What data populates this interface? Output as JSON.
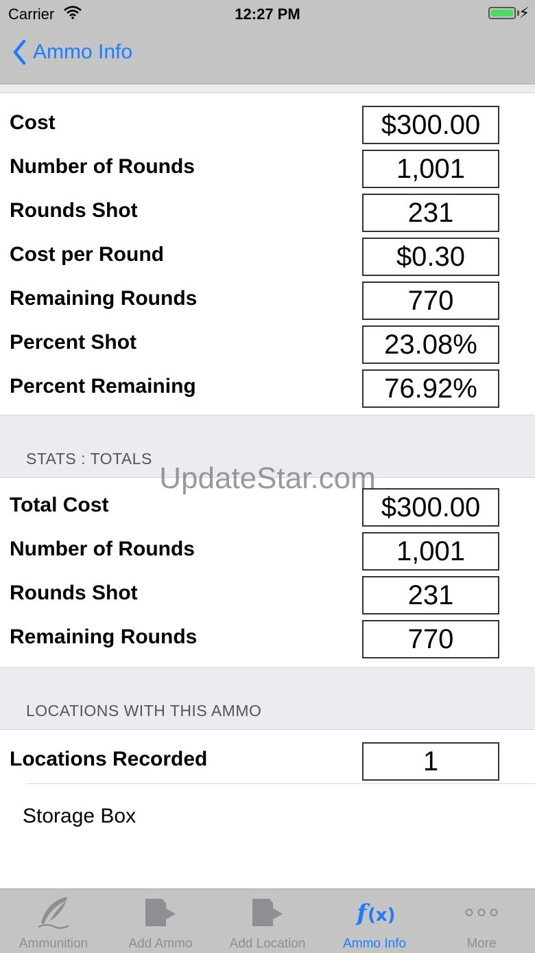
{
  "status": {
    "carrier": "Carrier",
    "time": "12:27 PM"
  },
  "nav": {
    "back_label": "Ammo Info"
  },
  "info": [
    {
      "label": "Cost",
      "value": "$300.00"
    },
    {
      "label": "Number of Rounds",
      "value": "1,001"
    },
    {
      "label": "Rounds Shot",
      "value": "231"
    },
    {
      "label": "Cost per Round",
      "value": "$0.30"
    },
    {
      "label": "Remaining Rounds",
      "value": "770"
    },
    {
      "label": "Percent Shot",
      "value": "23.08%"
    },
    {
      "label": "Percent Remaining",
      "value": "76.92%"
    }
  ],
  "totals": {
    "header": "STATS : TOTALS",
    "rows": [
      {
        "label": "Total Cost",
        "value": "$300.00"
      },
      {
        "label": "Number of Rounds",
        "value": "1,001"
      },
      {
        "label": "Rounds Shot",
        "value": "231"
      },
      {
        "label": "Remaining Rounds",
        "value": "770"
      }
    ]
  },
  "locations": {
    "header": "LOCATIONS WITH THIS AMMO",
    "recorded_label": "Locations Recorded",
    "recorded_value": "1",
    "items": [
      "Storage Box"
    ]
  },
  "watermark": "UpdateStar.com",
  "tabs": [
    {
      "label": "Ammunition",
      "icon": "quill-icon",
      "active": false
    },
    {
      "label": "Add Ammo",
      "icon": "add-document-icon",
      "active": false
    },
    {
      "label": "Add Location",
      "icon": "add-document-icon",
      "active": false
    },
    {
      "label": "Ammo Info",
      "icon": "function-icon",
      "active": true
    },
    {
      "label": "More",
      "icon": "more-icon",
      "active": false
    }
  ],
  "colors": {
    "accent": "#1a7cff",
    "bar": "#c4c4c4",
    "battery": "#4cd964"
  }
}
